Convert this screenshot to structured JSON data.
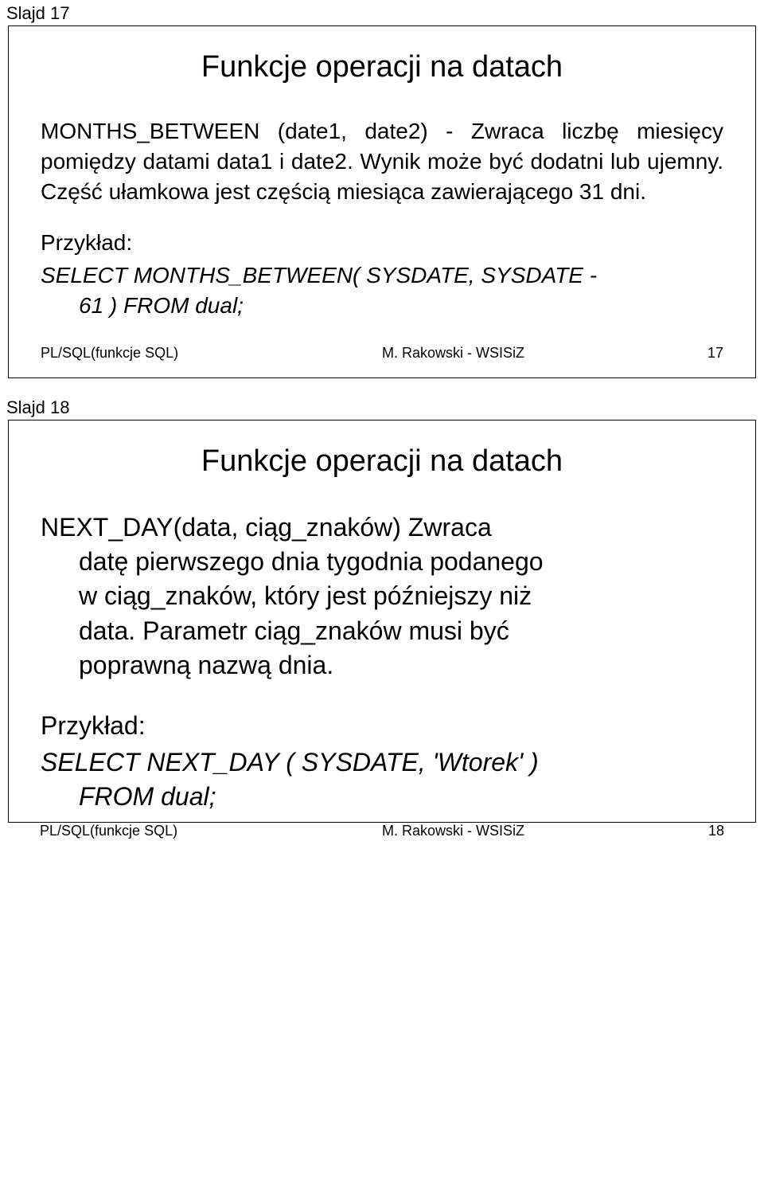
{
  "slide17": {
    "label": "Slajd 17",
    "title": "Funkcje operacji na datach",
    "body": "MONTHS_BETWEEN (date1, date2) - Zwraca liczbę miesięcy pomiędzy datami data1 i date2. Wynik może być dodatni lub ujemny. Część ułamkowa jest częścią miesiąca zawierającego 31 dni.",
    "example_label": "Przykład:",
    "example_line1": "SELECT MONTHS_BETWEEN( SYSDATE, SYSDATE -",
    "example_line2": "61 ) FROM dual;",
    "footer_left": "PL/SQL(funkcje SQL)",
    "footer_mid": "M. Rakowski - WSISiZ",
    "footer_right": "17"
  },
  "slide18": {
    "label": "Slajd 18",
    "title": "Funkcje operacji na datach",
    "body_line1": "NEXT_DAY(data, ciąg_znaków) Zwraca",
    "body_line2": "datę pierwszego dnia tygodnia podanego",
    "body_line3": "w ciąg_znaków, który jest późniejszy niż",
    "body_line4": "data. Parametr ciąg_znaków musi być",
    "body_line5": "poprawną nazwą dnia.",
    "example_label": "Przykład:",
    "example_line1": "SELECT NEXT_DAY ( SYSDATE, 'Wtorek' )",
    "example_line2": "FROM dual;",
    "footer_left": "PL/SQL(funkcje SQL)",
    "footer_mid": "M. Rakowski - WSISiZ",
    "footer_right": "18"
  }
}
